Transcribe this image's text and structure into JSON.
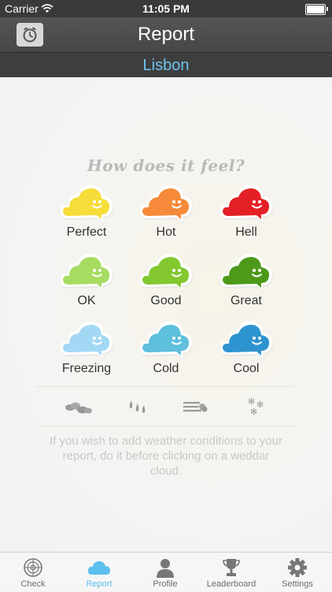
{
  "status_bar": {
    "carrier": "Carrier",
    "time": "11:05 PM"
  },
  "nav": {
    "title": "Report",
    "left_icon": "alarm-clock-icon"
  },
  "location": {
    "city": "Lisbon"
  },
  "report": {
    "heading": "How does it feel?",
    "clouds": [
      {
        "label": "Perfect",
        "color": "#f7dd3a"
      },
      {
        "label": "Hot",
        "color": "#f68a3a"
      },
      {
        "label": "Hell",
        "color": "#e42026"
      },
      {
        "label": "OK",
        "color": "#a6dc5f"
      },
      {
        "label": "Good",
        "color": "#82c82e"
      },
      {
        "label": "Great",
        "color": "#4d9a1a"
      },
      {
        "label": "Freezing",
        "color": "#a3d8f5"
      },
      {
        "label": "Cold",
        "color": "#5ec0dc"
      },
      {
        "label": "Cool",
        "color": "#2e94cf"
      }
    ],
    "conditions": [
      "cloudy-icon",
      "rain-icon",
      "wind-icon",
      "snow-icon"
    ],
    "hint": "If you wish to add weather conditions to your report, do it before clicking on a weddar cloud."
  },
  "tabs": [
    {
      "label": "Check",
      "icon": "radar-icon",
      "active": false
    },
    {
      "label": "Report",
      "icon": "cloud-icon",
      "active": true
    },
    {
      "label": "Profile",
      "icon": "profile-icon",
      "active": false
    },
    {
      "label": "Leaderboard",
      "icon": "trophy-icon",
      "active": false
    },
    {
      "label": "Settings",
      "icon": "gear-icon",
      "active": false
    }
  ],
  "colors": {
    "accent": "#5cc0ef",
    "nav_bg": "#4b4b4b"
  }
}
